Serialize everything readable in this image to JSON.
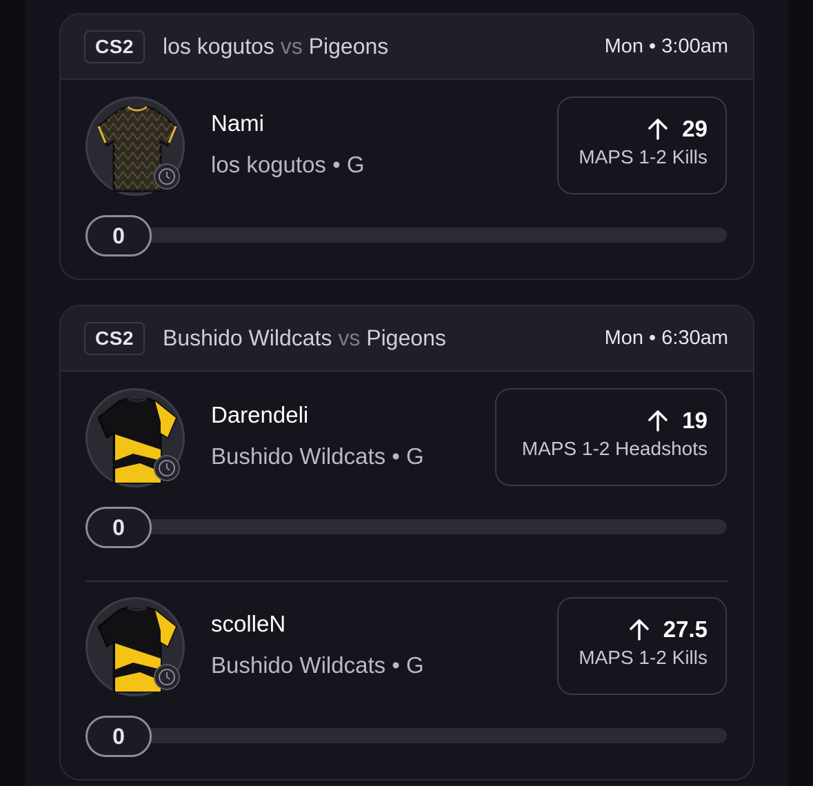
{
  "cards": [
    {
      "game": "CS2",
      "team_a": "los kogutos",
      "vs": "vs",
      "team_b": "Pigeons",
      "time": "Mon • 3:00am",
      "players": [
        {
          "name": "Nami",
          "subtitle": "los kogutos • G",
          "direction": "up",
          "line": "29",
          "market": "MAPS 1-2 Kills",
          "progress_value": "0",
          "jersey": "dark-patterned-jersey"
        }
      ]
    },
    {
      "game": "CS2",
      "team_a": "Bushido Wildcats",
      "vs": "vs",
      "team_b": "Pigeons",
      "time": "Mon • 6:30am",
      "players": [
        {
          "name": "Darendeli",
          "subtitle": "Bushido Wildcats • G",
          "direction": "up",
          "line": "19",
          "market": "MAPS 1-2 Headshots",
          "progress_value": "0",
          "jersey": "black-yellow-jersey"
        },
        {
          "name": "scolleN",
          "subtitle": "Bushido Wildcats • G",
          "direction": "up",
          "line": "27.5",
          "market": "MAPS 1-2 Kills",
          "progress_value": "0",
          "jersey": "black-yellow-jersey"
        }
      ]
    }
  ],
  "colors": {
    "background": "#14141c",
    "card": "#15151e",
    "header": "#1f1f29",
    "border": "#2b2b36",
    "text_primary": "#ffffff",
    "text_secondary": "#b9b9c4",
    "jersey_yellow": "#f3c316"
  }
}
